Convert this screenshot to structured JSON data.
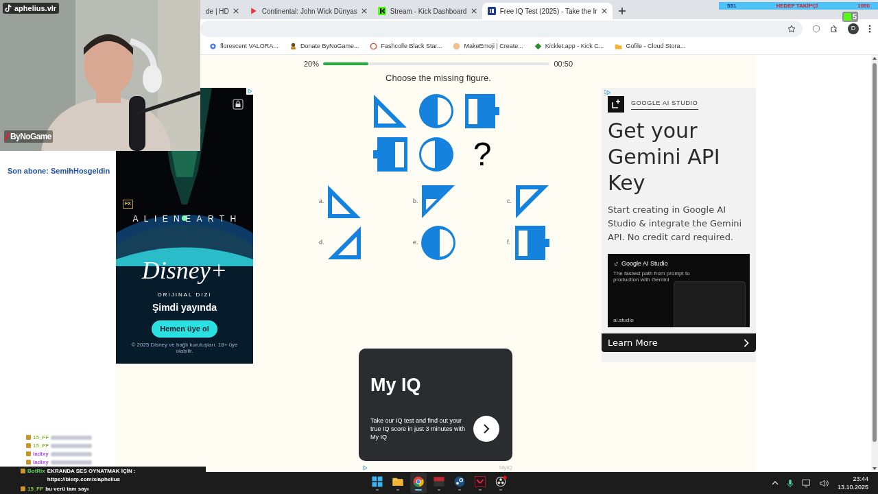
{
  "stream_overlay": {
    "channel": "aphelius.vlr",
    "brand": "ByNoGame",
    "last_subscriber": "Son abone: SemihHosgeldin",
    "goal": {
      "current": "551",
      "label": "HEDEF TAKİPÇİ",
      "target": "1000"
    },
    "viewer_badge": "5"
  },
  "tabs": [
    {
      "title": "de | HD",
      "selected": false,
      "kind": "partial"
    },
    {
      "title": "Continental: John Wick Dünyas",
      "selected": false,
      "kind": "video"
    },
    {
      "title": "Stream - Kick Dashboard",
      "selected": false,
      "kind": "kick"
    },
    {
      "title": "Free IQ Test (2025) - Take the Ir",
      "selected": true,
      "kind": "iq"
    }
  ],
  "toolbar": {
    "profile": "D"
  },
  "bookmarks": [
    {
      "label": "florescent VALORA...",
      "kind": "gear"
    },
    {
      "label": "Donate ByNoGame...",
      "kind": "person"
    },
    {
      "label": "Fashcolle Black Star...",
      "kind": "ring"
    },
    {
      "label": "MakeEmoji | Create...",
      "kind": "face"
    },
    {
      "label": "Kicklet.app - Kick C...",
      "kind": "kick"
    },
    {
      "label": "Gofile - Cloud Stora...",
      "kind": "folder"
    }
  ],
  "quiz": {
    "progress_text": "20%",
    "level": 0.2,
    "timer": "00:50",
    "question": "Choose the missing figure.",
    "matrix": [
      {
        "kind": "tri_bl"
      },
      {
        "kind": "circle_left"
      },
      {
        "kind": "battery_right"
      },
      {
        "kind": "battery_left"
      },
      {
        "kind": "circle_right"
      },
      {
        "kind": "unknown",
        "text": "?"
      }
    ],
    "options": [
      {
        "label": "a.",
        "kind": "tri_bl"
      },
      {
        "label": "b.",
        "kind": "tri_tl_filled"
      },
      {
        "label": "c.",
        "kind": "tri_tl"
      },
      {
        "label": "d.",
        "kind": "tri_br"
      },
      {
        "label": "e.",
        "kind": "circle_left"
      },
      {
        "label": "f.",
        "kind": "battery_right"
      }
    ]
  },
  "left_ad": {
    "network": "FX",
    "show": "ALIENEARTH",
    "brand": "Disney+",
    "tagline": "ORIJINAL DIZI",
    "headline": "Şimdi yayında",
    "button": "Hemen üye ol",
    "footer": "© 2025 Disney ve bağlı kuruluşları. 18+ üye olabilir."
  },
  "right_ad": {
    "advertiser": "GOOGLE AI STUDIO",
    "headline": "Get your Gemini API Key",
    "body": "Start creating in Google AI Studio & integrate the Gemini API. No credit card required.",
    "image": {
      "title": "Google AI Studio",
      "subtitle": "The fastest path from prompt to production with Gemini",
      "domain": "ai.studio"
    },
    "button": "Learn More"
  },
  "promo_card": {
    "title": "My IQ",
    "text": "Take our IQ test and find out your true IQ score in just 3 minutes with My IQ",
    "footer": "MyIQ"
  },
  "chat": [
    {
      "user": "15_FF",
      "color": "#8cc63f",
      "blurred": true
    },
    {
      "user": "15_FF",
      "color": "#8cc63f",
      "blurred": true
    },
    {
      "user": "ladixy",
      "color": "#a855f7",
      "blurred": true
    },
    {
      "user": "ladixy",
      "color": "#a855f7",
      "blurred": true
    },
    {
      "user": "BotRix",
      "color": "#5fd35f",
      "message": "EKRANDA SES OYNATMAK İÇİN :",
      "link": "https://blerp.com/x/aphelius",
      "dark": true
    },
    {
      "user": "15_FF",
      "color": "#8cc63f",
      "message": "bu verü tam sayı",
      "dark": true
    }
  ],
  "taskbar": {
    "apps": [
      {
        "kind": "windows",
        "active": false
      },
      {
        "kind": "folder",
        "active": false
      },
      {
        "kind": "chrome",
        "active": true
      },
      {
        "kind": "voicemeeter",
        "active": false
      },
      {
        "kind": "steam",
        "active": false
      },
      {
        "kind": "valorant",
        "active": false
      },
      {
        "kind": "obs",
        "active": false
      }
    ],
    "time": "23:44",
    "date": "13.10.2025"
  }
}
